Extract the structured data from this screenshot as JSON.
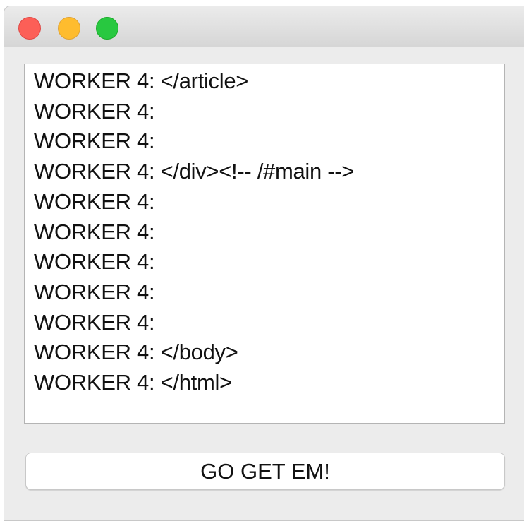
{
  "window": {
    "traffic_lights": [
      {
        "name": "close",
        "color": "#fc5f57"
      },
      {
        "name": "minimize",
        "color": "#febc2e"
      },
      {
        "name": "zoom",
        "color": "#28c840"
      }
    ]
  },
  "log": {
    "lines": [
      "WORKER 4: </article>",
      "WORKER 4:",
      "WORKER 4:",
      "WORKER 4: </div><!-- /#main -->",
      "WORKER 4:",
      "WORKER 4:",
      "WORKER 4:",
      "WORKER 4:",
      "WORKER 4:",
      "WORKER 4: </body>",
      "WORKER 4: </html>"
    ]
  },
  "action_button": {
    "label": "GO GET EM!"
  }
}
